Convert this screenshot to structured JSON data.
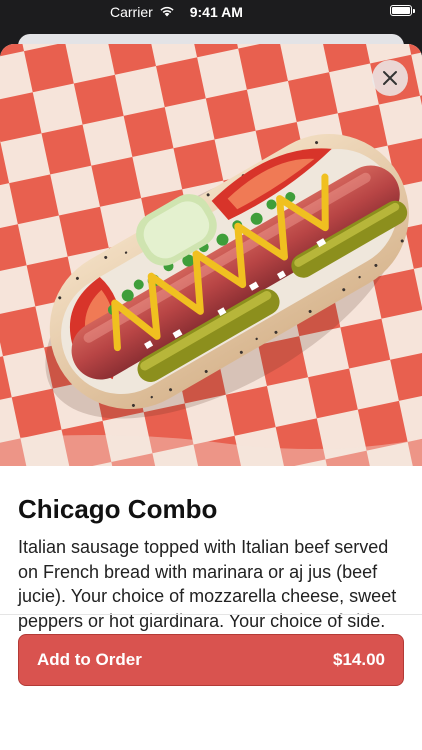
{
  "status_bar": {
    "carrier": "Carrier",
    "time": "9:41 AM"
  },
  "item": {
    "title": "Chicago Combo",
    "description": "Italian sausage topped with Italian beef served on French bread with marinara or aj jus (beef jucie). Your choice of mozzarella cheese, sweet peppers or hot giardinara. Your choice of side."
  },
  "order_button": {
    "label": "Add to Order",
    "price": "$14.00"
  },
  "colors": {
    "accent": "#d9534f",
    "checker_red": "#e8604f",
    "checker_light": "#f7e6dc"
  },
  "icons": {
    "close": "close-icon",
    "wifi": "wifi-icon",
    "battery": "battery-icon"
  }
}
